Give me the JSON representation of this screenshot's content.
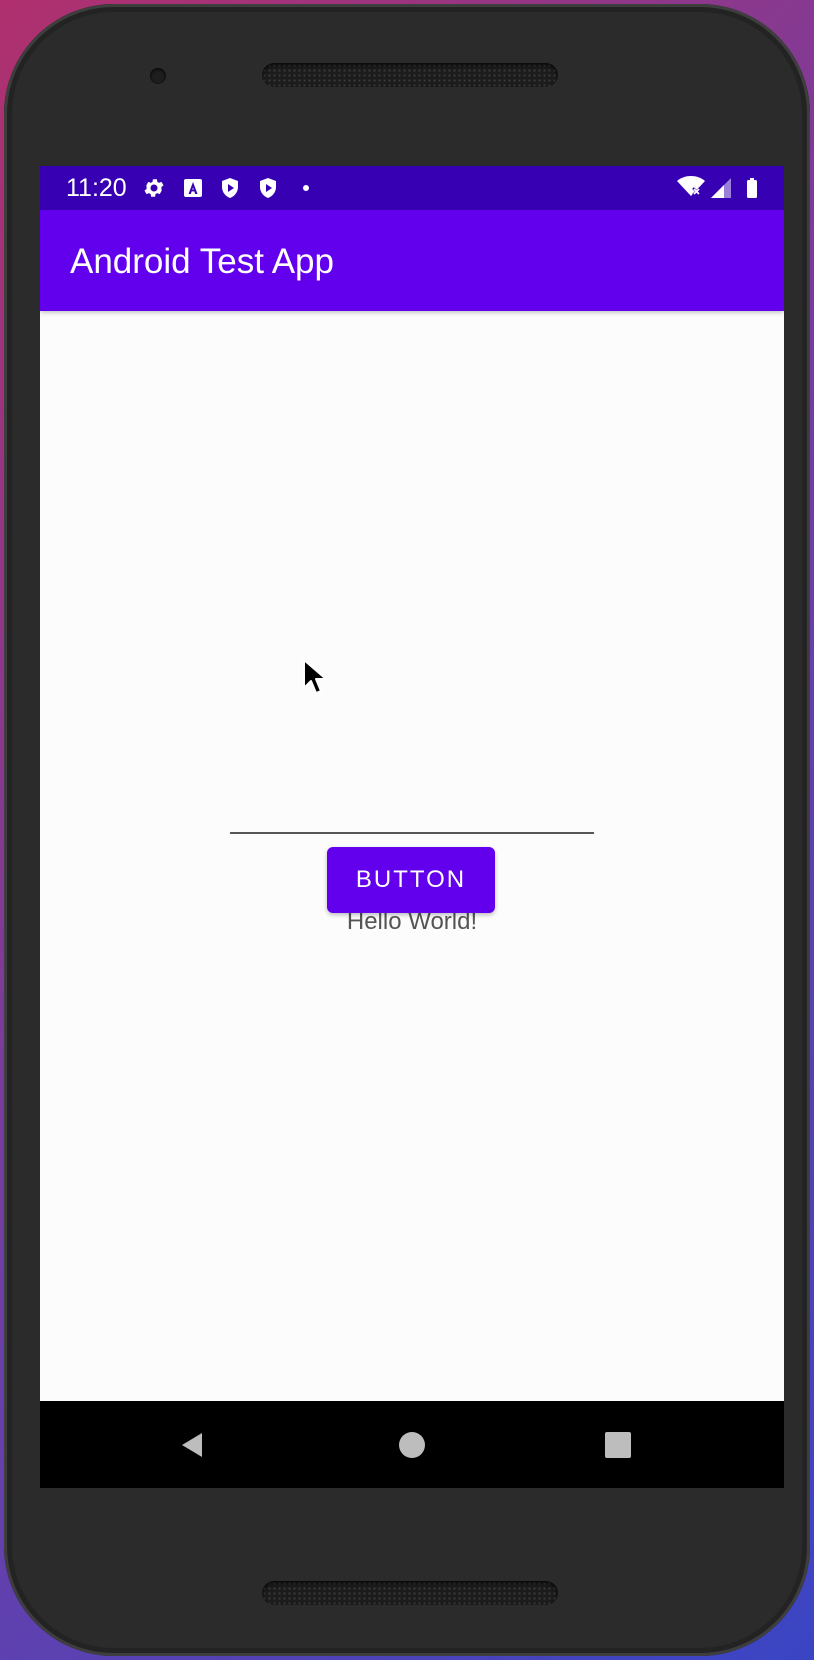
{
  "status_bar": {
    "time": "11:20",
    "left_icons": [
      "settings-icon",
      "a11y-a-icon",
      "shield-play-icon",
      "shield-play-icon",
      "dot-icon"
    ],
    "right_icons": [
      "wifi-off-icon",
      "cell-signal-icon",
      "battery-icon"
    ],
    "color": "#3700b3"
  },
  "app_bar": {
    "title": "Android Test App",
    "color": "#6200ee"
  },
  "main": {
    "edit_text_value": "",
    "hello_text": "Hello World!",
    "button_label": "BUTTON"
  },
  "nav_bar": {
    "icons": [
      "back-icon",
      "home-icon",
      "recents-icon"
    ]
  }
}
